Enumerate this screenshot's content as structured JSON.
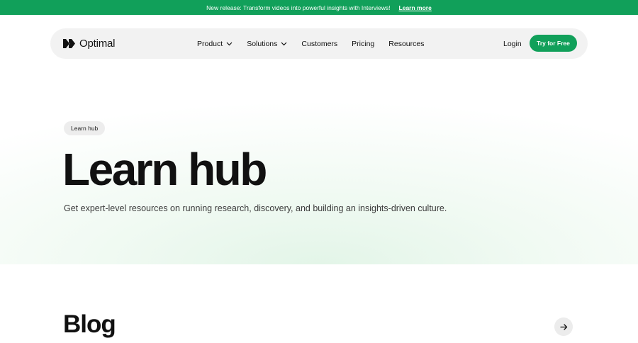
{
  "announcement": {
    "text": "New release: Transform videos into powerful insights with Interviews!",
    "link_label": "Learn more"
  },
  "nav": {
    "brand": "Optimal",
    "links": [
      {
        "label": "Product",
        "has_dropdown": true
      },
      {
        "label": "Solutions",
        "has_dropdown": true
      },
      {
        "label": "Customers",
        "has_dropdown": false
      },
      {
        "label": "Pricing",
        "has_dropdown": false
      },
      {
        "label": "Resources",
        "has_dropdown": false
      }
    ],
    "login_label": "Login",
    "cta_label": "Try for Free"
  },
  "hero": {
    "pill": "Learn hub",
    "title": "Learn hub",
    "subtitle": "Get expert-level resources on running research, discovery, and building an insights-driven culture."
  },
  "blog": {
    "title": "Blog"
  },
  "icons": {
    "logo": "optimal-logo-icon",
    "dropdown": "chevron-down-icon",
    "next": "arrow-right-icon"
  },
  "colors": {
    "brand_green": "#11a05a",
    "nav_bg": "#f2f2f2",
    "pill_bg": "#ededed"
  }
}
